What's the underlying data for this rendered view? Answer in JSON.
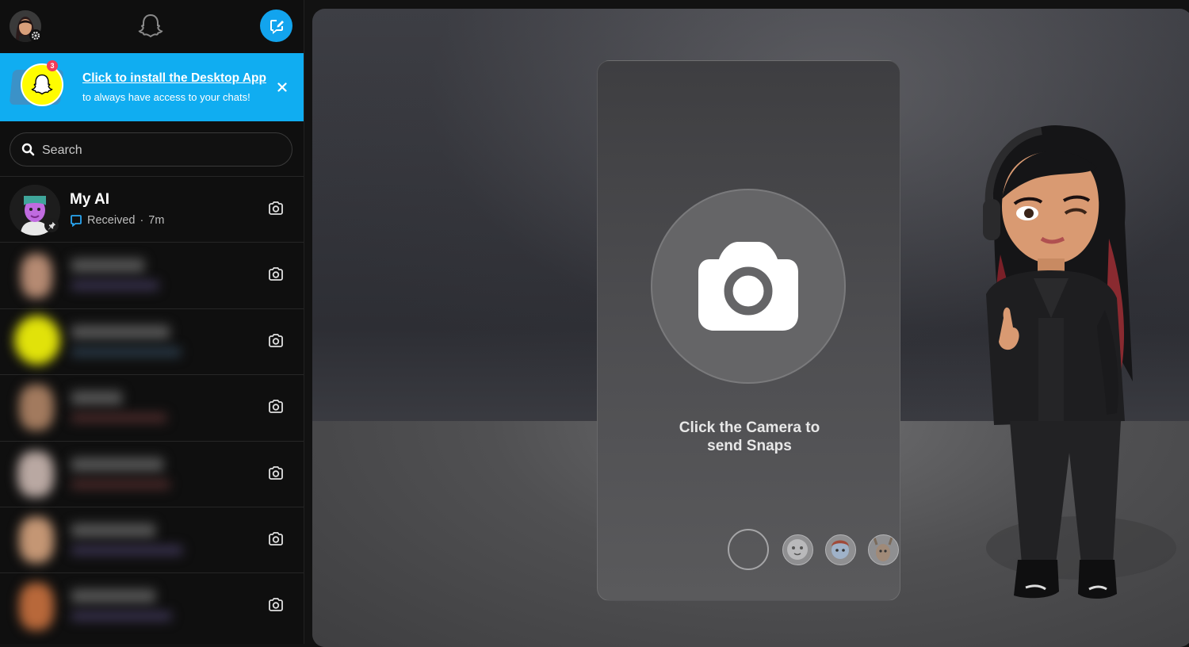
{
  "banner": {
    "badge_count": "3",
    "link_text": "Click to install the Desktop App",
    "subtext": "to always have access to your chats!"
  },
  "search": {
    "placeholder": "Search"
  },
  "chats": [
    {
      "name": "My AI",
      "status": "Received",
      "time": "7m",
      "pinned": true
    }
  ],
  "camera": {
    "line1": "Click the Camera to",
    "line2": "send Snaps"
  },
  "colors": {
    "brand_blue": "#10adf1",
    "snap_yellow": "#fffc00",
    "sidebar_bg": "#0f0f0f",
    "badge_red": "#f23c57"
  },
  "icons": [
    "gear-icon",
    "ghost-logo-icon",
    "new-chat-icon",
    "close-icon",
    "search-icon",
    "chat-bubble-icon",
    "camera-icon",
    "pin-icon"
  ]
}
